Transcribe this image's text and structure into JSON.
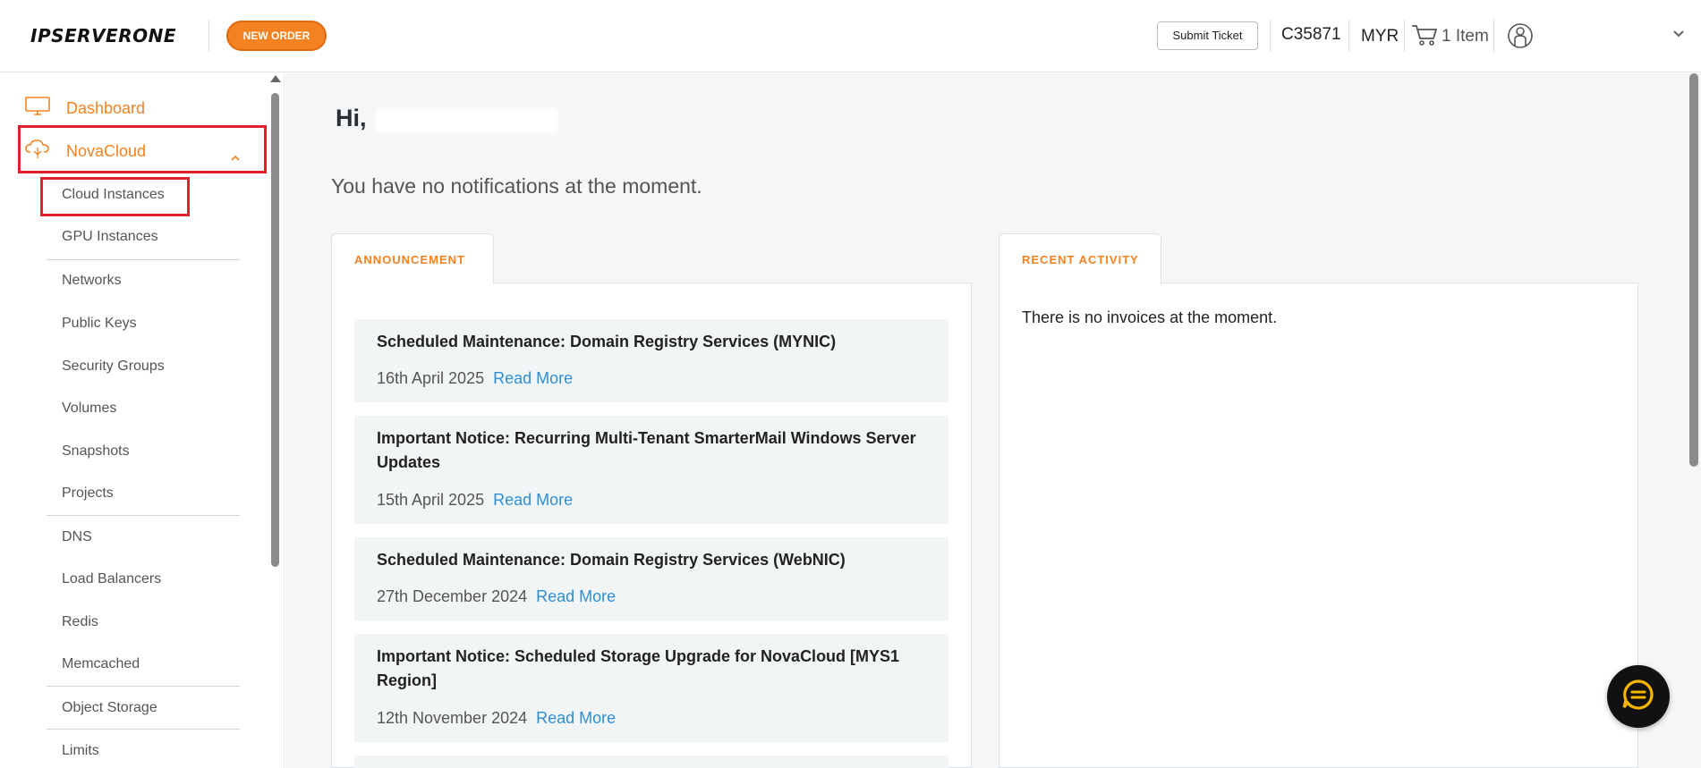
{
  "header": {
    "logo_text": "IPSERVERONE",
    "new_order_label": "NEW ORDER",
    "submit_ticket_label": "Submit Ticket",
    "client_id": "C35871",
    "currency": "MYR",
    "cart_label": "1 Item"
  },
  "sidebar": {
    "dashboard_label": "Dashboard",
    "novacloud_label": "NovaCloud",
    "sub_items": [
      {
        "label": "Cloud Instances"
      },
      {
        "label": "GPU Instances"
      },
      {
        "label": "Networks"
      },
      {
        "label": "Public Keys"
      },
      {
        "label": "Security Groups"
      },
      {
        "label": "Volumes"
      },
      {
        "label": "Snapshots"
      },
      {
        "label": "Projects"
      },
      {
        "label": "DNS"
      },
      {
        "label": "Load Balancers"
      },
      {
        "label": "Redis"
      },
      {
        "label": "Memcached"
      },
      {
        "label": "Object Storage"
      },
      {
        "label": "Limits"
      }
    ]
  },
  "main": {
    "greeting": "Hi,",
    "notifications_text": "You have no notifications at the moment.",
    "announcement_tab": "ANNOUNCEMENT",
    "recent_activity_tab": "RECENT ACTIVITY",
    "no_invoices_text": "There is no invoices at the moment.",
    "announcements": [
      {
        "title": "Scheduled Maintenance: Domain Registry Services (MYNIC)",
        "date": "16th April 2025",
        "link": "Read More"
      },
      {
        "title": "Important Notice: Recurring Multi-Tenant SmarterMail Windows Server Updates",
        "date": "15th April 2025",
        "link": "Read More"
      },
      {
        "title": "Scheduled Maintenance: Domain Registry Services (WebNIC)",
        "date": "27th December 2024",
        "link": "Read More"
      },
      {
        "title": "Important Notice: Scheduled Storage Upgrade for NovaCloud [MYS1 Region]",
        "date": "12th November 2024",
        "link": "Read More"
      }
    ]
  },
  "colors": {
    "accent": "#f58220",
    "highlight_box": "#e0202a",
    "link": "#2f8fd6"
  },
  "icons": [
    "monitor-icon",
    "cloud-icon",
    "chevron-up-icon",
    "cart-icon",
    "user-icon",
    "chevron-down-icon",
    "chat-icon"
  ]
}
